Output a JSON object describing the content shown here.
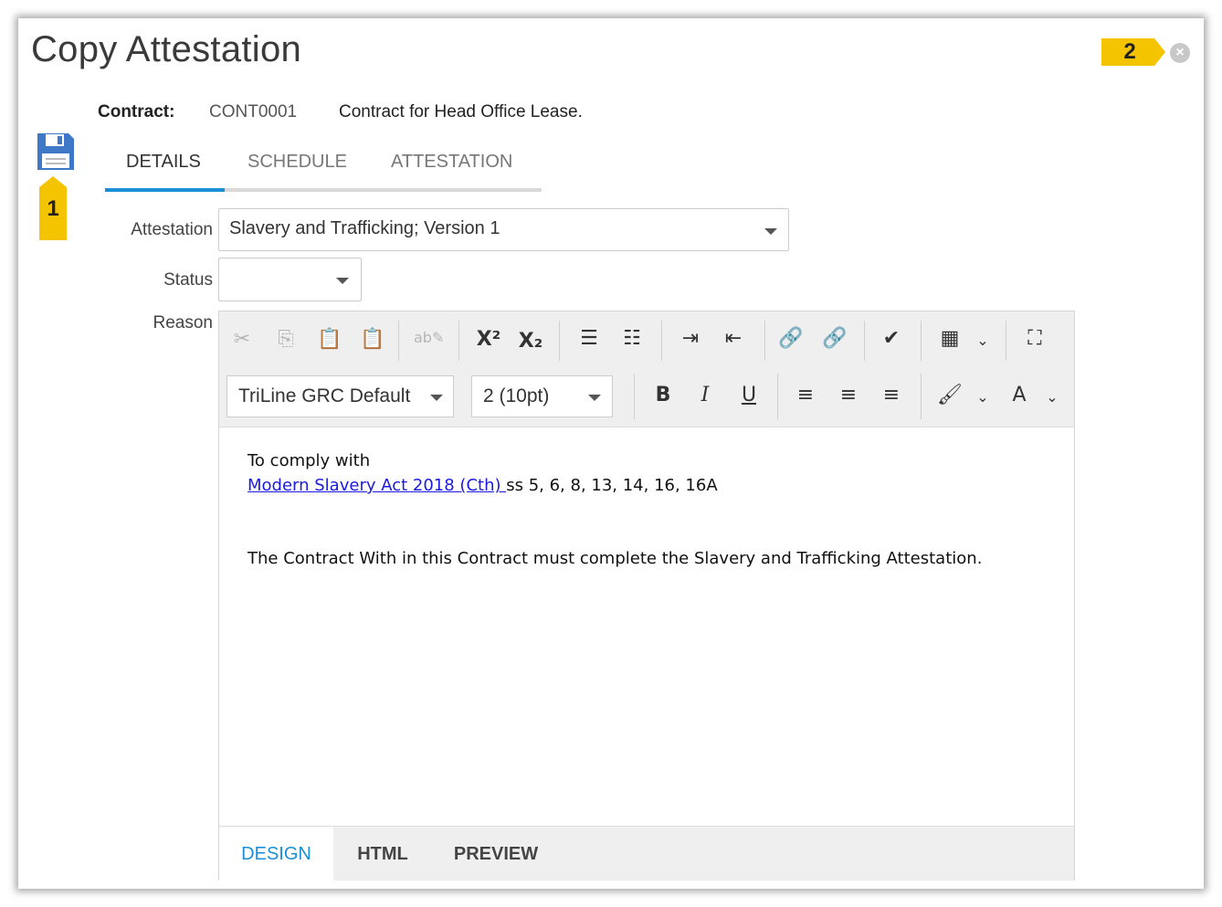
{
  "dialog": {
    "title": "Copy Attestation",
    "close_icon": "close-circle-icon"
  },
  "callouts": {
    "save_badge": "1",
    "close_badge": "2",
    "badge_color": "#f5c400"
  },
  "contract": {
    "label": "Contract:",
    "code": "CONT0001",
    "description": "Contract for Head Office Lease."
  },
  "tabs": [
    {
      "label": "DETAILS",
      "active": true
    },
    {
      "label": "SCHEDULE",
      "active": false
    },
    {
      "label": "ATTESTATION",
      "active": false
    }
  ],
  "form": {
    "attestation_label": "Attestation",
    "attestation_value": "Slavery and Trafficking; Version 1",
    "status_label": "Status",
    "status_value": "",
    "reason_label": "Reason"
  },
  "editor": {
    "font_family": "TriLine GRC Default",
    "font_size": "2 (10pt)",
    "content": {
      "line1": "To comply with",
      "link_text": "Modern Slavery Act 2018 (Cth) ",
      "line2_rest": "ss 5, 6, 8, 13, 14, 16, 16A",
      "line3": "The Contract With in this Contract must complete the Slavery and Trafficking Attestation."
    },
    "footer_tabs": [
      {
        "label": "DESIGN",
        "active": true
      },
      {
        "label": "HTML",
        "active": false
      },
      {
        "label": "PREVIEW",
        "active": false
      }
    ]
  },
  "colors": {
    "accent": "#1b8fd6",
    "link": "#1a1ae0",
    "save_icon": "#3e78c6"
  }
}
